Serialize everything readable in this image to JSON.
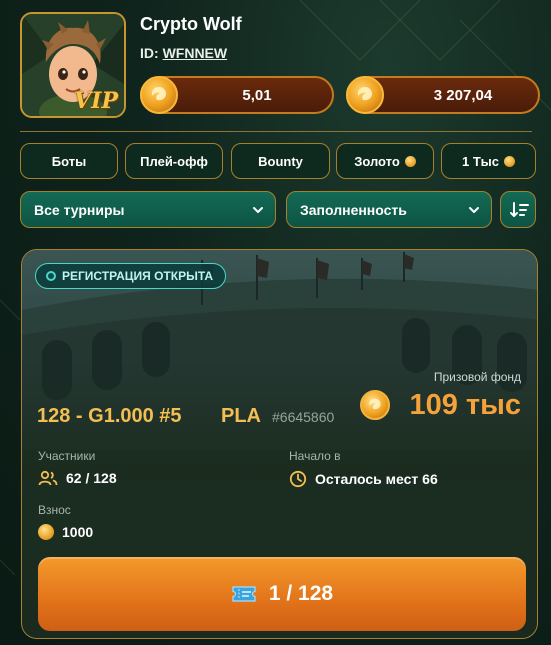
{
  "profile": {
    "name": "Crypto Wolf",
    "id_label": "ID:",
    "id_value": "WFNNEW",
    "vip_badge": "VIP"
  },
  "balances": [
    {
      "icon": "gold-coin-icon",
      "amount": "5,01"
    },
    {
      "icon": "gold-coin-icon",
      "amount": "3 207,04"
    }
  ],
  "filters": [
    {
      "label": "Боты",
      "coin": false
    },
    {
      "label": "Плей-офф",
      "coin": false
    },
    {
      "label": "Bounty",
      "coin": false
    },
    {
      "label": "Золото",
      "coin": true
    },
    {
      "label": "1 Тыс",
      "coin": true
    }
  ],
  "dropdowns": {
    "tournaments": "Все турниры",
    "fill": "Заполненность"
  },
  "tournament": {
    "status": "РЕГИСТРАЦИЯ ОТКРЫТА",
    "prize_label": "Призовой фонд",
    "prize_value": "109 тыс",
    "name": "128 - G1.000 #5",
    "game": "PLA",
    "number": "#6645860",
    "participants_label": "Участники",
    "participants_value": "62 / 128",
    "start_label": "Начало в",
    "start_value": "Осталось мест 66",
    "fee_label": "Взнос",
    "fee_value": "1000",
    "cta_label": "1 / 128"
  },
  "colors": {
    "background": "#0f241c",
    "gold_accent": "#a8802c",
    "orange_cta": "#e2731a",
    "prize_orange": "#f6a23a",
    "title_gold": "#f3bf52",
    "teal_dropdown": "#136a55"
  }
}
